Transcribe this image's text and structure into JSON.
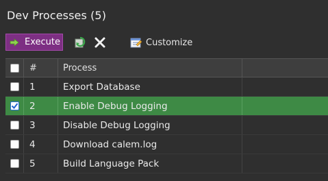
{
  "window": {
    "title": "Dev Processes (5)"
  },
  "toolbar": {
    "execute_label": "Execute",
    "customize_label": "Customize"
  },
  "grid": {
    "columns": {
      "num": "#",
      "process": "Process"
    },
    "rows": [
      {
        "num": "1",
        "process": "Export Database",
        "checked": false
      },
      {
        "num": "2",
        "process": "Enable Debug Logging",
        "checked": true
      },
      {
        "num": "3",
        "process": "Disable Debug Logging",
        "checked": false
      },
      {
        "num": "4",
        "process": "Download calem.log",
        "checked": false
      },
      {
        "num": "5",
        "process": "Build Language Pack",
        "checked": false
      }
    ]
  },
  "colors": {
    "accent": "#7d2f83",
    "selected_row": "#3e8a45",
    "background": "#2f2f2f"
  },
  "icons": [
    "arrow-right-icon",
    "refresh-icon",
    "close-icon",
    "customize-icon",
    "checkmark-icon"
  ]
}
